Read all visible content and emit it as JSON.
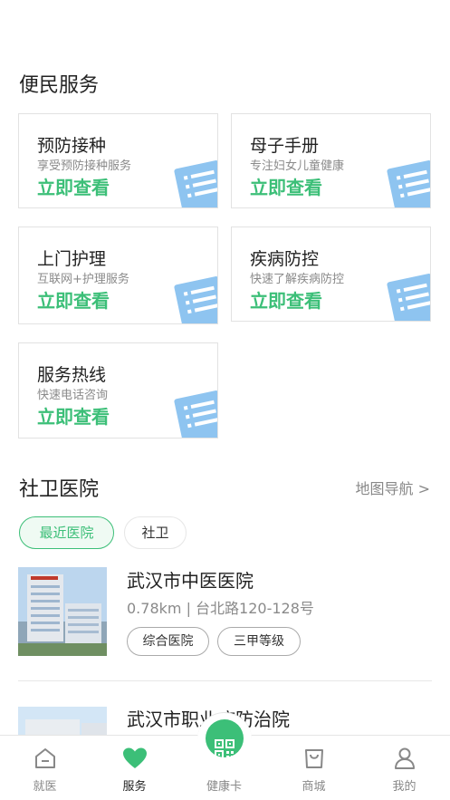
{
  "services": {
    "title": "便民服务",
    "cta": "立即查看",
    "items": [
      {
        "title": "预防接种",
        "subtitle": "享受预防接种服务"
      },
      {
        "title": "母子手册",
        "subtitle": "专注妇女儿童健康"
      },
      {
        "title": "上门护理",
        "subtitle": "互联网+护理服务"
      },
      {
        "title": "疾病防控",
        "subtitle": "快速了解疾病防控"
      },
      {
        "title": "服务热线",
        "subtitle": "快速电话咨询"
      }
    ]
  },
  "hospitals": {
    "title": "社卫医院",
    "map_link": "地图导航 >",
    "filters": [
      "最近医院",
      "社卫"
    ],
    "list": [
      {
        "name": "武汉市中医医院",
        "info": "0.78km | 台北路120-128号",
        "tags": [
          "综合医院",
          "三甲等级"
        ]
      },
      {
        "name": "武汉市职业病防治院"
      }
    ]
  },
  "tabbar": {
    "items": [
      {
        "label": "就医",
        "icon": "home-icon"
      },
      {
        "label": "服务",
        "icon": "heart-icon"
      },
      {
        "label": "健康卡",
        "icon": "qr-code-icon"
      },
      {
        "label": "商城",
        "icon": "shopping-bag-icon"
      },
      {
        "label": "我的",
        "icon": "user-icon"
      }
    ],
    "active": "服务"
  },
  "colors": {
    "accent": "#3cbf78",
    "icon_blue": "#8ec4f0"
  }
}
